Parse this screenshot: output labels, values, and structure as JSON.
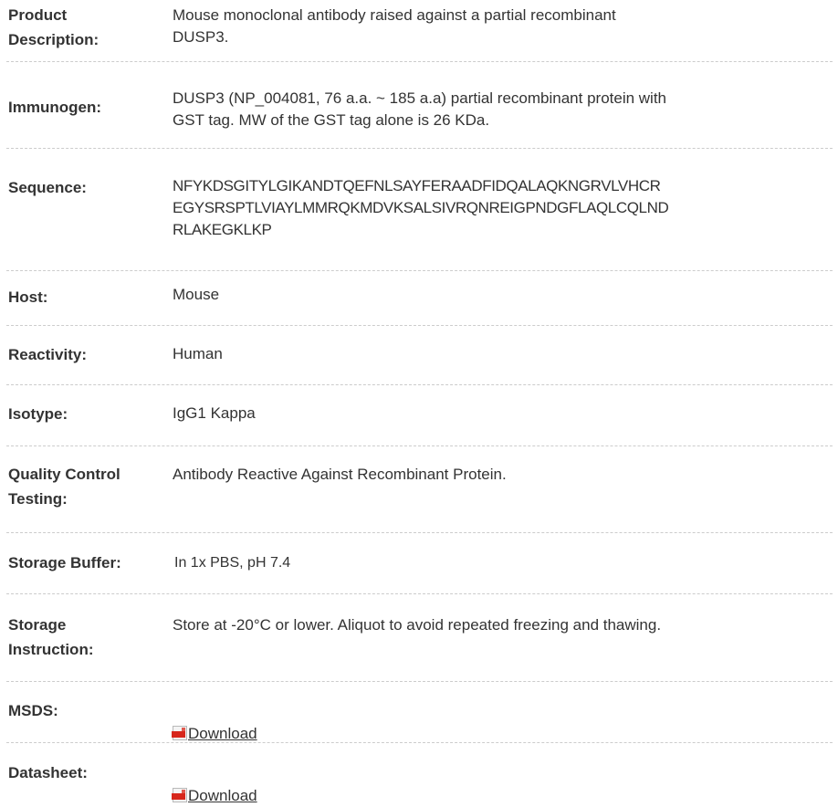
{
  "rows": [
    {
      "label": "Product\nDescription:",
      "value": "Mouse monoclonal antibody raised against a partial recombinant\nDUSP3."
    },
    {
      "label": "Immunogen:",
      "value": "DUSP3 (NP_004081, 76 a.a. ~ 185 a.a) partial recombinant protein with\nGST tag. MW of the GST tag alone is 26 KDa."
    },
    {
      "label": "Sequence:",
      "value": "NFYKDSGITYLGIKANDTQEFNLSAYFERAADFIDQALAQKNGRVLVHCR\nEGYSRSPTLVIAYLMMRQKMDVKSALSIVRQNREIGPNDGFLAQLCQLND\nRLAKEGKLKP"
    },
    {
      "label": "Host:",
      "value": "Mouse"
    },
    {
      "label": "Reactivity:",
      "value": "Human"
    },
    {
      "label": "Isotype:",
      "value": "IgG1 Kappa"
    },
    {
      "label": "Quality Control\nTesting:",
      "value": "Antibody Reactive Against Recombinant Protein."
    },
    {
      "label": "Storage Buffer:",
      "value": "In 1x PBS, pH 7.4"
    },
    {
      "label": "Storage\nInstruction:",
      "value": "Store at -20°C or lower. Aliquot to avoid repeated freezing and thawing."
    },
    {
      "label": "MSDS:",
      "link_text": "Download",
      "icon": "pdf-icon"
    },
    {
      "label": "Datasheet:",
      "link_text": "Download",
      "icon": "pdf-icon"
    }
  ]
}
